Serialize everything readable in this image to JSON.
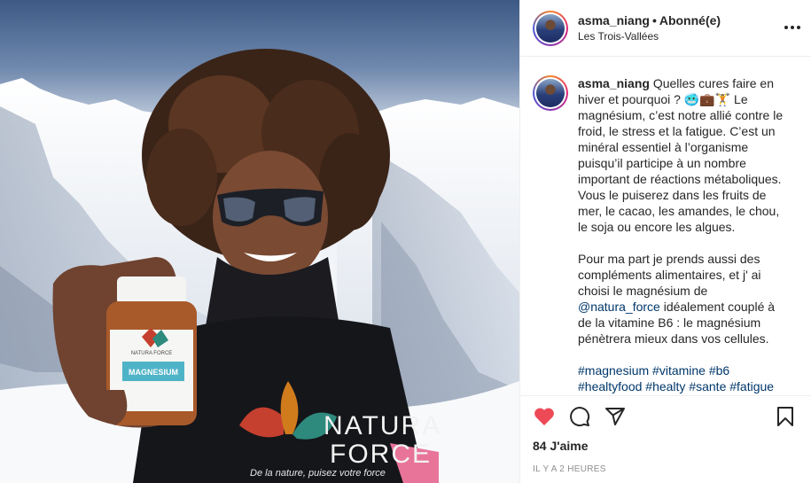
{
  "post": {
    "username": "asma_niang",
    "separator": "•",
    "follow_status": "Abonné(e)",
    "location": "Les Trois-Vallées"
  },
  "caption": {
    "username": "asma_niang",
    "paragraph1": "Quelles cures faire en hiver et pourquoi ? 🥶💼🏋️ Le magnésium, c’est notre allié contre le froid, le stress et la fatigue. C’est un minéral essentiel à l’organisme puisqu’il participe à un nombre important de réactions métaboliques. Vous le puiserez dans les fruits de mer, le cacao, les amandes, le chou, le soja ou encore les algues.",
    "paragraph2_start": "Pour ma part je prends aussi des compléments alimentaires, et j' ai choisi le magnésium de ",
    "mention": "@natura_force",
    "paragraph2_end": " idéalement couplé à de la vitamine B6 : le magnésium pénètrera mieux dans vos cellules.",
    "hashtags": "#magnesium #vitamine #b6 #healtyfood #healty #sante #fatigue"
  },
  "photo": {
    "jar_brand": "NATURA FORCE",
    "jar_label": "MAGNESIUM",
    "shirt_text_line1": "NATURA",
    "shirt_text_line2": "FORCE",
    "shirt_slogan": "De la nature, puisez votre force"
  },
  "actions": {
    "icons": [
      "heart-icon",
      "comment-icon",
      "share-icon",
      "bookmark-icon"
    ],
    "like_color": "#ed4956",
    "likes": "84 J'aime",
    "timestamp": "IL Y A 2 HEURES"
  }
}
